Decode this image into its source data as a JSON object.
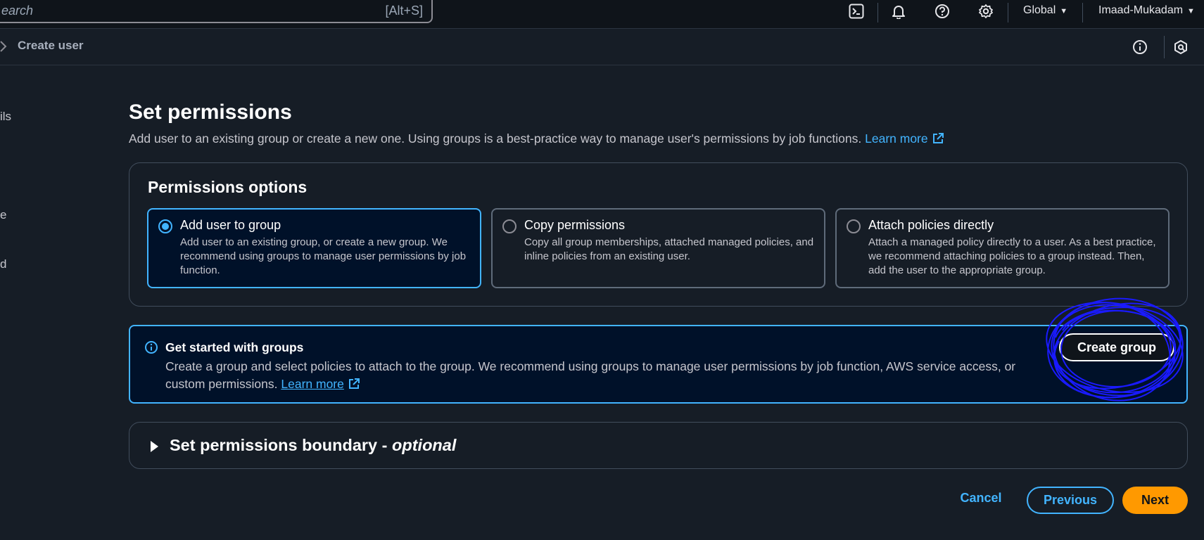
{
  "topbar": {
    "search_placeholder": "earch",
    "search_shortcut": "[Alt+S]",
    "region": "Global",
    "account": "Imaad-Mukadam"
  },
  "breadcrumb": {
    "current": "Create user"
  },
  "sidebar_fragments": [
    "ils",
    "e",
    "d"
  ],
  "page": {
    "title": "Set permissions",
    "description": "Add user to an existing group or create a new one. Using groups is a best-practice way to manage user's permissions by job functions.",
    "learn_more": "Learn more"
  },
  "permissions": {
    "title": "Permissions options",
    "options": [
      {
        "label": "Add user to group",
        "description": "Add user to an existing group, or create a new group. We recommend using groups to manage user permissions by job function.",
        "selected": true
      },
      {
        "label": "Copy permissions",
        "description": "Copy all group memberships, attached managed policies, and inline policies from an existing user.",
        "selected": false
      },
      {
        "label": "Attach policies directly",
        "description": "Attach a managed policy directly to a user. As a best practice, we recommend attaching policies to a group instead. Then, add the user to the appropriate group.",
        "selected": false
      }
    ]
  },
  "info_box": {
    "title": "Get started with groups",
    "body": "Create a group and select policies to attach to the group. We recommend using groups to manage user permissions by job function, AWS service access, or custom permissions.",
    "learn_more": "Learn more",
    "create_group": "Create group"
  },
  "boundary": {
    "title": "Set permissions boundary - ",
    "optional": "optional"
  },
  "footer": {
    "cancel": "Cancel",
    "previous": "Previous",
    "next": "Next"
  },
  "colors": {
    "background": "#161d26",
    "accent": "#42b4ff",
    "primary_button": "#ff9900",
    "annotation": "#1a1aff"
  }
}
